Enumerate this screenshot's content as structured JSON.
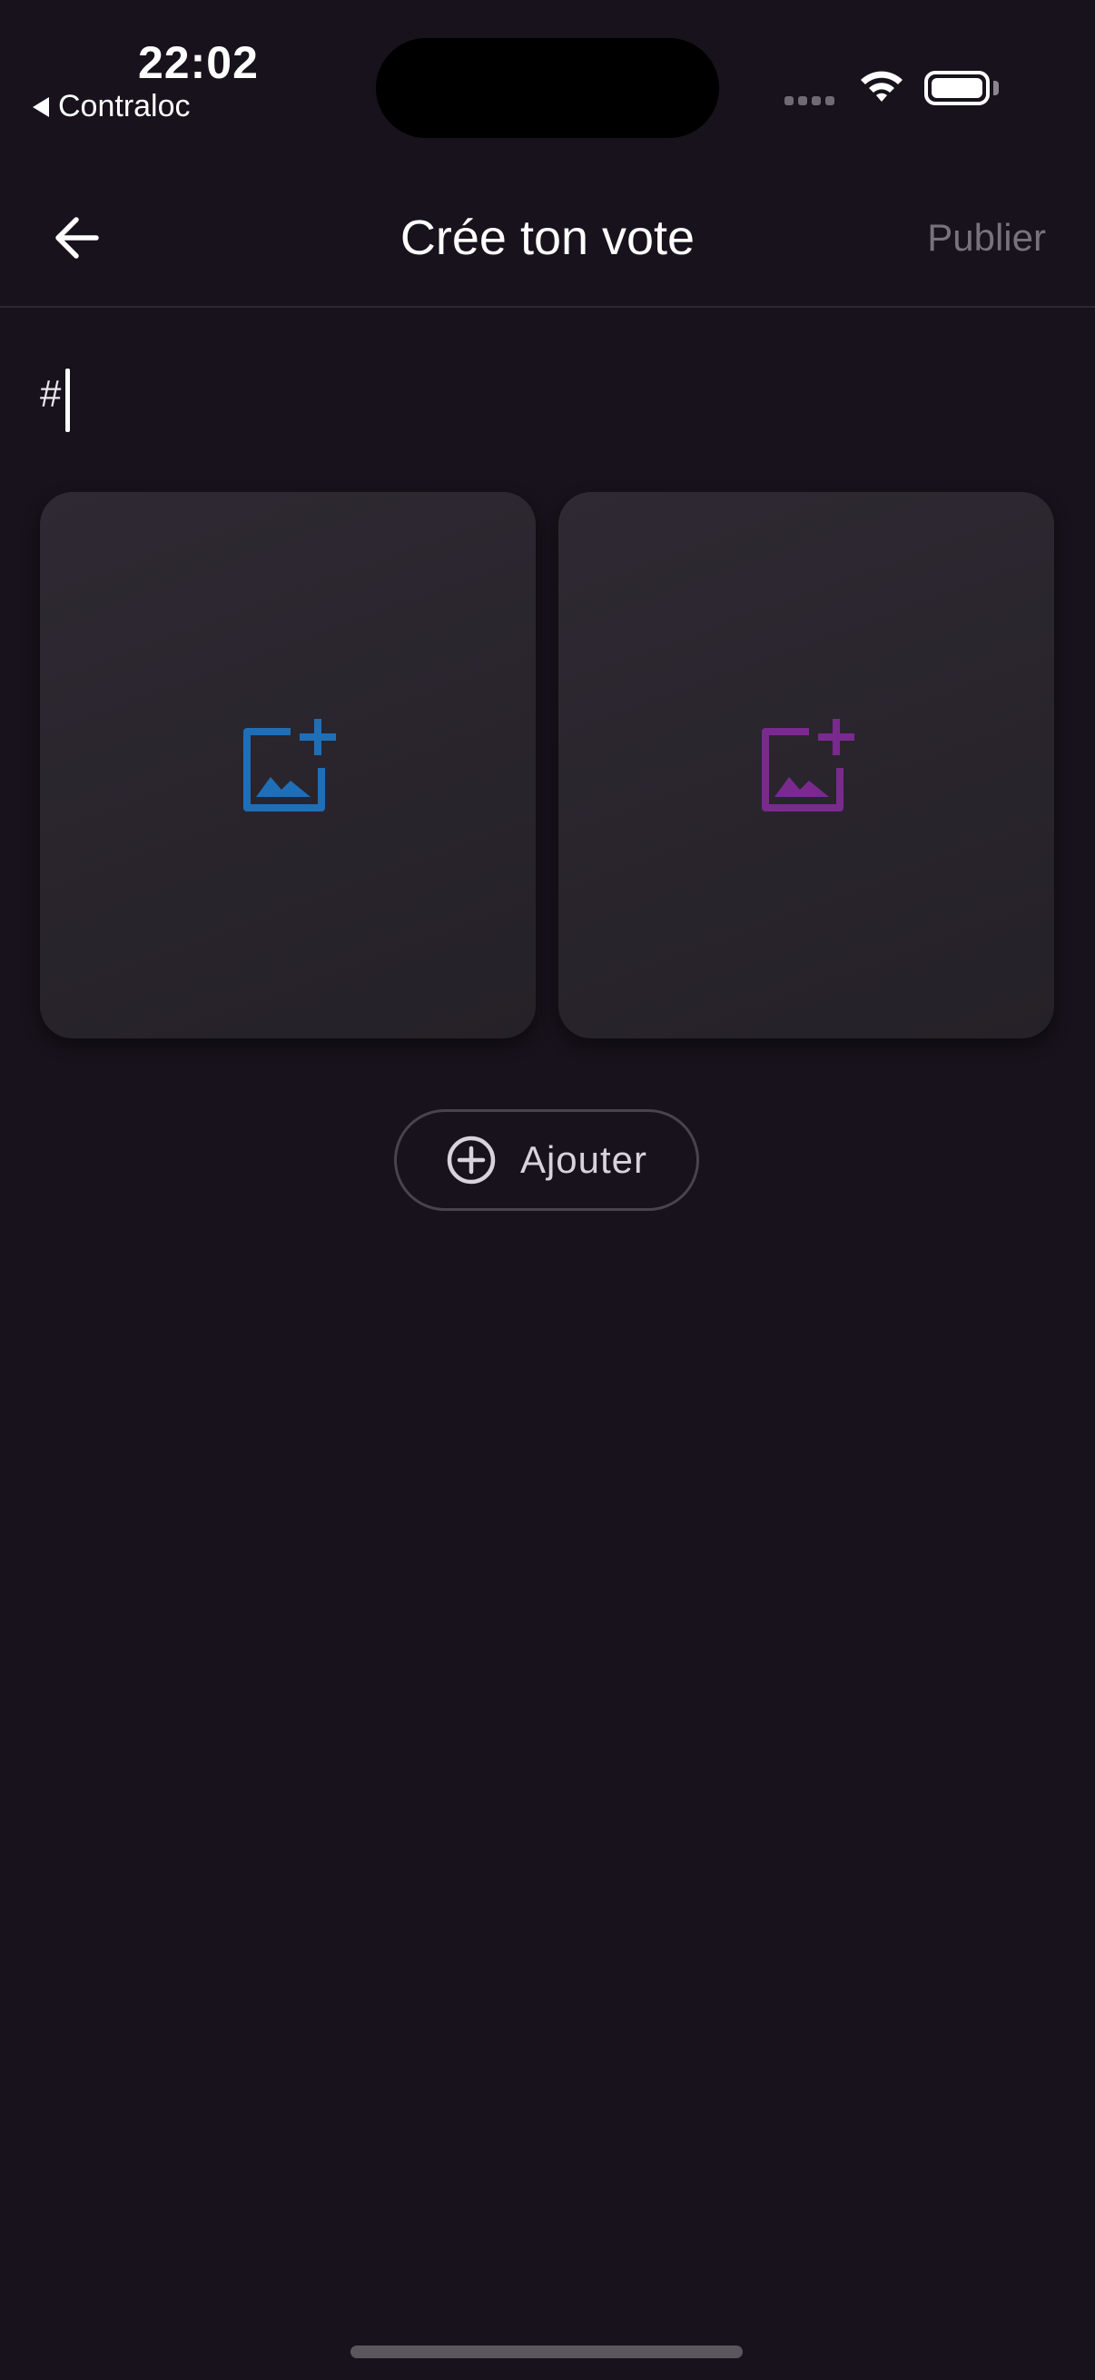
{
  "status_bar": {
    "time": "22:02",
    "back_app_label": "Contraloc",
    "icons": [
      "signal-icon",
      "wifi-icon",
      "battery-icon"
    ]
  },
  "app_bar": {
    "title": "Crée ton vote",
    "publish_label": "Publier",
    "back_icon": "arrow-left-icon"
  },
  "tag_input": {
    "value": "#"
  },
  "options": [
    {
      "icon": "add-photo-icon",
      "color": "#1f6fb8"
    },
    {
      "icon": "add-photo-icon",
      "color": "#7a2a8f"
    }
  ],
  "add_button": {
    "label": "Ajouter",
    "icon": "plus-circle-icon"
  },
  "colors": {
    "background": "#17121b",
    "card": "#2a252e",
    "muted_text": "#77727c"
  }
}
